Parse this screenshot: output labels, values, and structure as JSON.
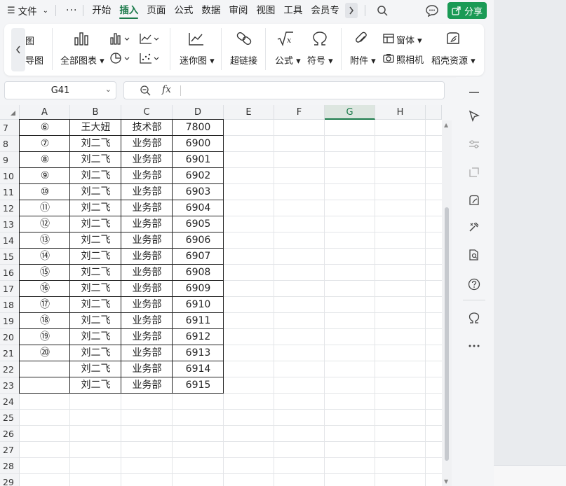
{
  "menubar": {
    "file_label": "文件",
    "items": [
      "开始",
      "插入",
      "页面",
      "公式",
      "数据",
      "审阅",
      "视图",
      "工具",
      "会员专"
    ],
    "active_index": 1,
    "share_label": "分享",
    "accent": "#1a9a55"
  },
  "ribbon": {
    "partial_top": "图",
    "partial_bottom": "导图",
    "all_charts": "全部图表",
    "sparkline": "迷你图",
    "hyperlink": "超链接",
    "formula": "公式",
    "symbol": "符号",
    "attachment": "附件",
    "form": "窗体",
    "camera": "照相机",
    "resources": "稻壳资源"
  },
  "formula_bar": {
    "cell_ref": "G41",
    "fx_label": "fx",
    "formula": ""
  },
  "sheet": {
    "columns": [
      "A",
      "B",
      "C",
      "D",
      "E",
      "F",
      "G",
      "H"
    ],
    "selected_column": "G",
    "rows": [
      {
        "num": "7",
        "a": "⑥",
        "b": "王大妞",
        "c": "技术部",
        "d": "7800"
      },
      {
        "num": "8",
        "a": "⑦",
        "b": "刘二飞",
        "c": "业务部",
        "d": "6900"
      },
      {
        "num": "9",
        "a": "⑧",
        "b": "刘二飞",
        "c": "业务部",
        "d": "6901"
      },
      {
        "num": "10",
        "a": "⑨",
        "b": "刘二飞",
        "c": "业务部",
        "d": "6902"
      },
      {
        "num": "11",
        "a": "⑩",
        "b": "刘二飞",
        "c": "业务部",
        "d": "6903"
      },
      {
        "num": "12",
        "a": "⑪",
        "b": "刘二飞",
        "c": "业务部",
        "d": "6904"
      },
      {
        "num": "13",
        "a": "⑫",
        "b": "刘二飞",
        "c": "业务部",
        "d": "6905"
      },
      {
        "num": "14",
        "a": "⑬",
        "b": "刘二飞",
        "c": "业务部",
        "d": "6906"
      },
      {
        "num": "15",
        "a": "⑭",
        "b": "刘二飞",
        "c": "业务部",
        "d": "6907"
      },
      {
        "num": "16",
        "a": "⑮",
        "b": "刘二飞",
        "c": "业务部",
        "d": "6908"
      },
      {
        "num": "17",
        "a": "⑯",
        "b": "刘二飞",
        "c": "业务部",
        "d": "6909"
      },
      {
        "num": "18",
        "a": "⑰",
        "b": "刘二飞",
        "c": "业务部",
        "d": "6910"
      },
      {
        "num": "19",
        "a": "⑱",
        "b": "刘二飞",
        "c": "业务部",
        "d": "6911"
      },
      {
        "num": "20",
        "a": "⑲",
        "b": "刘二飞",
        "c": "业务部",
        "d": "6912"
      },
      {
        "num": "21",
        "a": "⑳",
        "b": "刘二飞",
        "c": "业务部",
        "d": "6913"
      },
      {
        "num": "22",
        "a": "",
        "b": "刘二飞",
        "c": "业务部",
        "d": "6914"
      },
      {
        "num": "23",
        "a": "",
        "b": "刘二飞",
        "c": "业务部",
        "d": "6915"
      },
      {
        "num": "24",
        "a": "",
        "b": "",
        "c": "",
        "d": ""
      },
      {
        "num": "25",
        "a": "",
        "b": "",
        "c": "",
        "d": ""
      },
      {
        "num": "26",
        "a": "",
        "b": "",
        "c": "",
        "d": ""
      },
      {
        "num": "27",
        "a": "",
        "b": "",
        "c": "",
        "d": ""
      },
      {
        "num": "28",
        "a": "",
        "b": "",
        "c": "",
        "d": ""
      },
      {
        "num": "29",
        "a": "",
        "b": "",
        "c": "",
        "d": ""
      }
    ]
  },
  "side_panel": {
    "icons": [
      "collapse-icon",
      "select-pointer-icon",
      "adjust-icon",
      "transform-icon",
      "resource-icon",
      "tools-icon",
      "book-search-icon",
      "help-icon",
      "omega-icon",
      "more-icon"
    ]
  }
}
